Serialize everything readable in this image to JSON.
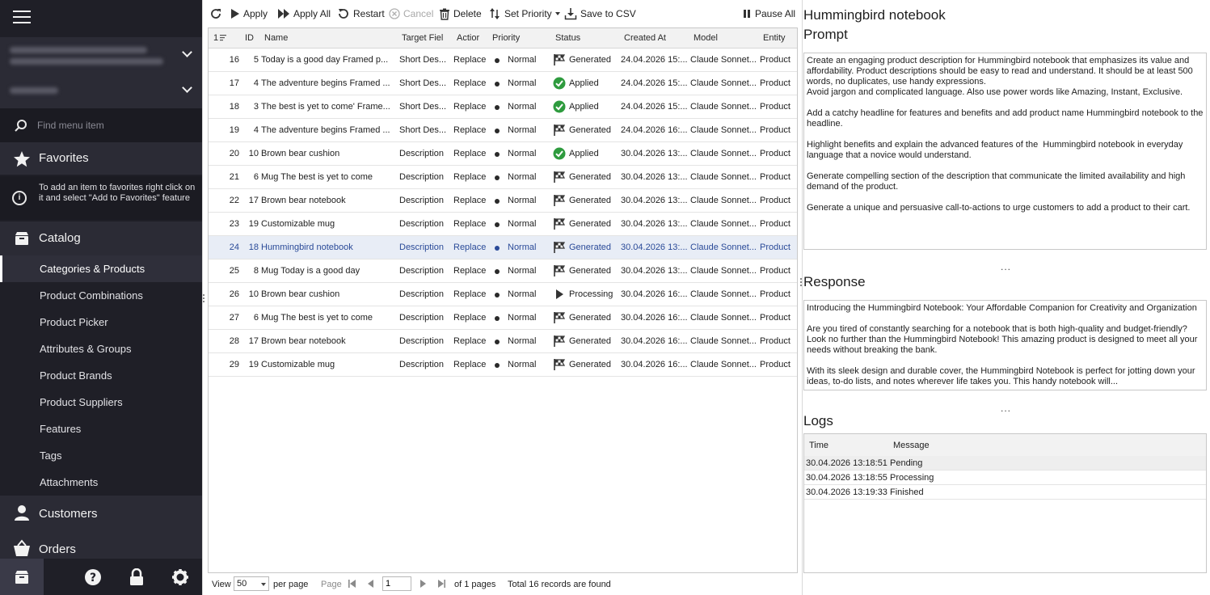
{
  "sidebar": {
    "search_placeholder": "Find menu item",
    "favorites_label": "Favorites",
    "favorites_hint": "To add an item to favorites right click on it and select \"Add to Favorites\" feature",
    "catalog_label": "Catalog",
    "catalog_items": [
      "Categories & Products",
      "Product Combinations",
      "Product Picker",
      "Attributes & Groups",
      "Product Brands",
      "Product Suppliers",
      "Features",
      "Tags",
      "Attachments"
    ],
    "customers_label": "Customers",
    "orders_label": "Orders"
  },
  "toolbar": {
    "apply": "Apply",
    "apply_all": "Apply All",
    "restart": "Restart",
    "cancel": "Cancel",
    "delete": "Delete",
    "set_priority": "Set Priority",
    "save_csv": "Save to CSV",
    "pause_all": "Pause All"
  },
  "grid": {
    "columns": [
      "1",
      "ID",
      "Name",
      "Target Fiel",
      "Actior",
      "Priority",
      "Status",
      "Created At",
      "Model",
      "Entity"
    ],
    "rows": [
      {
        "n": "16",
        "id": "5",
        "name": "Today is a good day Framed p...",
        "target": "Short Des...",
        "action": "Replace",
        "priority": "Normal",
        "status": "Generated",
        "status_icon": "flag-icon",
        "created": "24.04.2026 15:...",
        "model": "Claude Sonnet...",
        "entity": "Product"
      },
      {
        "n": "17",
        "id": "4",
        "name": "The adventure begins Framed ...",
        "target": "Short Des...",
        "action": "Replace",
        "priority": "Normal",
        "status": "Applied",
        "status_icon": "check-icon",
        "created": "24.04.2026 15:...",
        "model": "Claude Sonnet...",
        "entity": "Product"
      },
      {
        "n": "18",
        "id": "3",
        "name": "The best is yet to come' Frame...",
        "target": "Short Des...",
        "action": "Replace",
        "priority": "Normal",
        "status": "Applied",
        "status_icon": "check-icon",
        "created": "24.04.2026 15:...",
        "model": "Claude Sonnet...",
        "entity": "Product"
      },
      {
        "n": "19",
        "id": "4",
        "name": "The adventure begins Framed ...",
        "target": "Short Des...",
        "action": "Replace",
        "priority": "Normal",
        "status": "Generated",
        "status_icon": "flag-icon",
        "created": "24.04.2026 16:...",
        "model": "Claude Sonnet...",
        "entity": "Product"
      },
      {
        "n": "20",
        "id": "10",
        "name": "Brown bear cushion",
        "target": "Description",
        "action": "Replace",
        "priority": "Normal",
        "status": "Applied",
        "status_icon": "check-icon",
        "created": "30.04.2026 13:...",
        "model": "Claude Sonnet...",
        "entity": "Product"
      },
      {
        "n": "21",
        "id": "6",
        "name": "Mug The best is yet to come",
        "target": "Description",
        "action": "Replace",
        "priority": "Normal",
        "status": "Generated",
        "status_icon": "flag-icon",
        "created": "30.04.2026 13:...",
        "model": "Claude Sonnet...",
        "entity": "Product"
      },
      {
        "n": "22",
        "id": "17",
        "name": "Brown bear notebook",
        "target": "Description",
        "action": "Replace",
        "priority": "Normal",
        "status": "Generated",
        "status_icon": "flag-icon",
        "created": "30.04.2026 13:...",
        "model": "Claude Sonnet...",
        "entity": "Product"
      },
      {
        "n": "23",
        "id": "19",
        "name": "Customizable mug",
        "target": "Description",
        "action": "Replace",
        "priority": "Normal",
        "status": "Generated",
        "status_icon": "flag-icon",
        "created": "30.04.2026 13:...",
        "model": "Claude Sonnet...",
        "entity": "Product"
      },
      {
        "n": "24",
        "id": "18",
        "name": "Hummingbird notebook",
        "target": "Description",
        "action": "Replace",
        "priority": "Normal",
        "status": "Generated",
        "status_icon": "flag-icon",
        "created": "30.04.2026 13:...",
        "model": "Claude Sonnet...",
        "entity": "Product",
        "selected": true
      },
      {
        "n": "25",
        "id": "8",
        "name": "Mug Today is a good day",
        "target": "Description",
        "action": "Replace",
        "priority": "Normal",
        "status": "Generated",
        "status_icon": "flag-icon",
        "created": "30.04.2026 13:...",
        "model": "Claude Sonnet...",
        "entity": "Product"
      },
      {
        "n": "26",
        "id": "10",
        "name": "Brown bear cushion",
        "target": "Description",
        "action": "Replace",
        "priority": "Normal",
        "status": "Processing",
        "status_icon": "play-icon",
        "created": "30.04.2026 16:...",
        "model": "Claude Sonnet...",
        "entity": "Product"
      },
      {
        "n": "27",
        "id": "6",
        "name": "Mug The best is yet to come",
        "target": "Description",
        "action": "Replace",
        "priority": "Normal",
        "status": "Generated",
        "status_icon": "flag-icon",
        "created": "30.04.2026 16:...",
        "model": "Claude Sonnet...",
        "entity": "Product"
      },
      {
        "n": "28",
        "id": "17",
        "name": "Brown bear notebook",
        "target": "Description",
        "action": "Replace",
        "priority": "Normal",
        "status": "Generated",
        "status_icon": "flag-icon",
        "created": "30.04.2026 16:...",
        "model": "Claude Sonnet...",
        "entity": "Product"
      },
      {
        "n": "29",
        "id": "19",
        "name": "Customizable mug",
        "target": "Description",
        "action": "Replace",
        "priority": "Normal",
        "status": "Generated",
        "status_icon": "flag-icon",
        "created": "30.04.2026 16:...",
        "model": "Claude Sonnet...",
        "entity": "Product"
      }
    ]
  },
  "pager": {
    "view_label": "View",
    "page_size": "50",
    "per_page": "per page",
    "page_label": "Page",
    "page_value": "1",
    "of_pages": "of 1 pages",
    "total": "Total 16 records are found"
  },
  "detail": {
    "title": "Hummingbird notebook",
    "prompt_label": "Prompt",
    "prompt_text": "Create an engaging product description for Hummingbird notebook that emphasizes its value and affordability. Product descriptions should be easy to read and understand. It should be at least 500 words, no duplicates, use handy expressions.\nAvoid jargon and complicated language. Also use power words like Amazing, Instant, Exclusive.\n\nAdd a catchy headline for features and benefits and add product name Hummingbird notebook to the headline.\n\nHighlight benefits and explain the advanced features of the  Hummingbird notebook in everyday language that a novice would understand.\n\nGenerate compelling section of the description that communicate the limited availability and high demand of the product.\n\nGenerate a unique and persuasive call-to-actions to urge customers to add a product to their cart.",
    "response_label": "Response",
    "response_text": "Introducing the Hummingbird Notebook: Your Affordable Companion for Creativity and Organization\n\nAre you tired of constantly searching for a notebook that is both high-quality and budget-friendly? Look no further than the Hummingbird Notebook! This amazing product is designed to meet all your needs without breaking the bank.\n\nWith its sleek design and durable cover, the Hummingbird Notebook is perfect for jotting down your ideas, to-do lists, and notes wherever life takes you. This handy notebook will...",
    "dots": "...",
    "logs_label": "Logs",
    "log_columns": [
      "Time",
      "Message"
    ],
    "logs": [
      {
        "time": "30.04.2026 13:18:51",
        "message": "Pending"
      },
      {
        "time": "30.04.2026 13:18:55",
        "message": "Processing"
      },
      {
        "time": "30.04.2026 13:19:33",
        "message": "Finished"
      }
    ]
  },
  "colors": {
    "sidebar_bg": "#1f1f27",
    "sidebar_section": "#2b2b35",
    "selected_row": "#e8edf6",
    "applied_green": "#2e9b3e"
  }
}
